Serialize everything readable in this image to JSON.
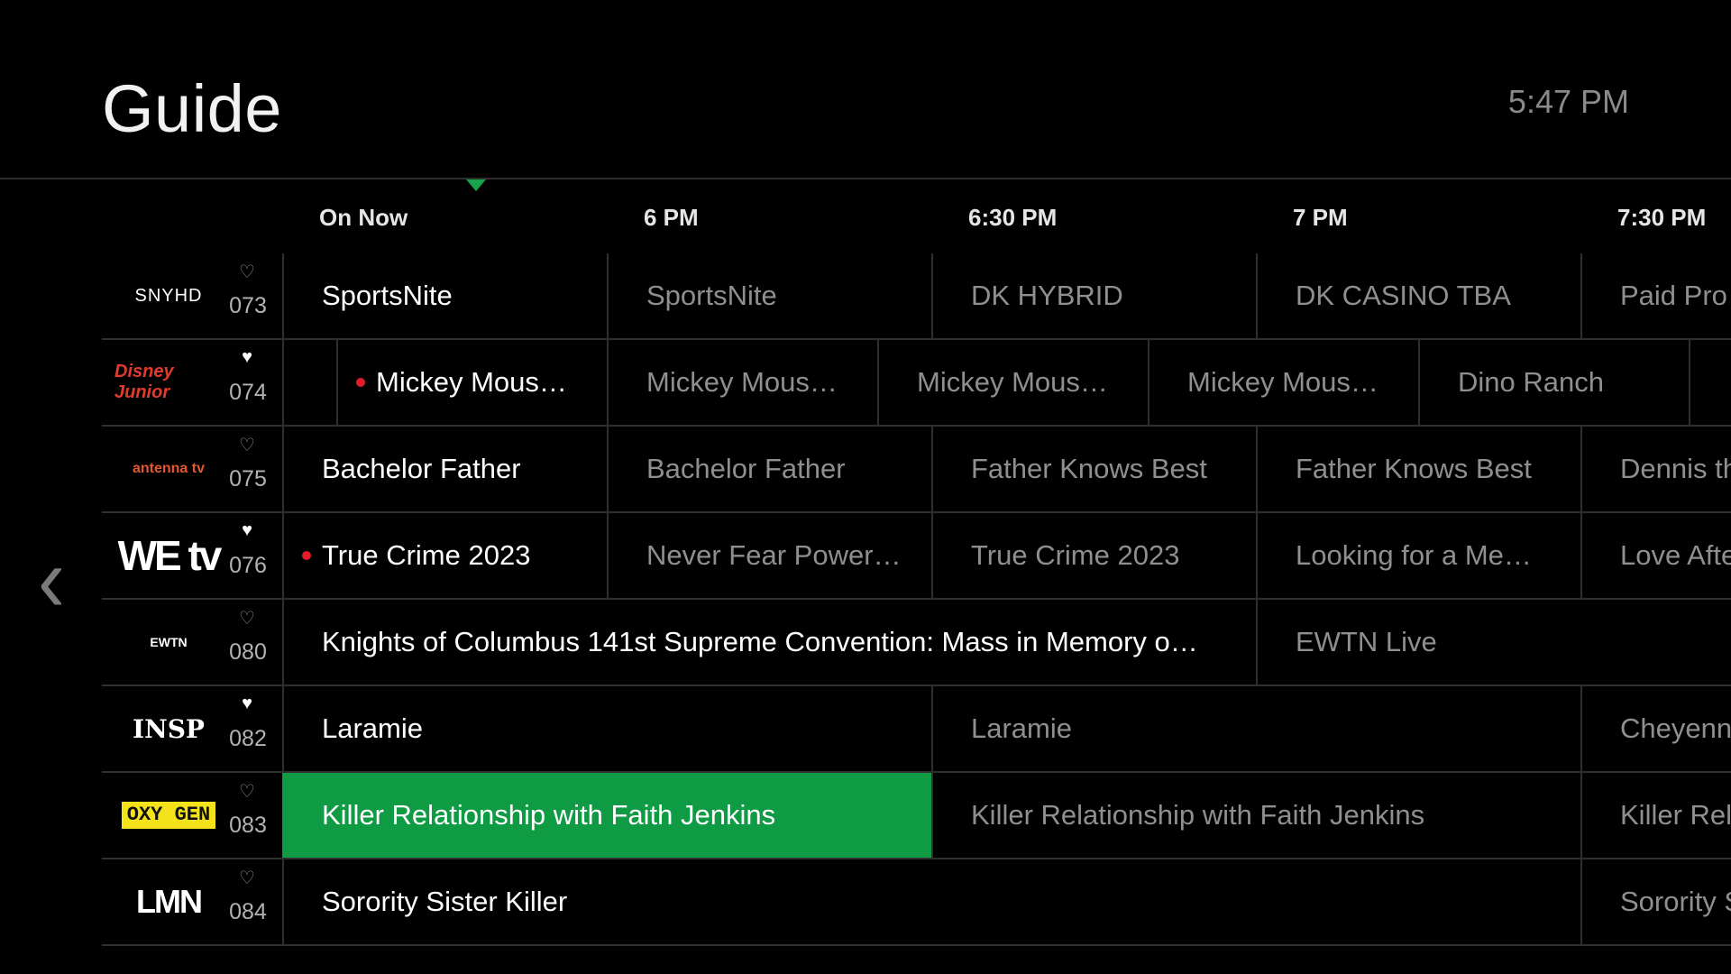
{
  "header": {
    "title": "Guide",
    "clock": "5:47 PM"
  },
  "timebar": [
    "On Now",
    "6 PM",
    "6:30 PM",
    "7 PM",
    "7:30 PM"
  ],
  "rows": [
    {
      "channel": {
        "logo_text": "SNYHD",
        "number": "073",
        "favorite": false
      },
      "programs": [
        "SportsNite",
        "SportsNite",
        "DK HYBRID",
        "DK CASINO TBA",
        "Paid Pro"
      ]
    },
    {
      "channel": {
        "logo_text": "Disney Junior",
        "number": "074",
        "favorite": true
      },
      "programs": [
        "Mickey Mous…",
        "Mickey Mous…",
        "Mickey Mous…",
        "Mickey Mous…",
        "Dino Ranch"
      ]
    },
    {
      "channel": {
        "logo_text": "antenna tv",
        "number": "075",
        "favorite": false
      },
      "programs": [
        "Bachelor Father",
        "Bachelor Father",
        "Father Knows Best",
        "Father Knows Best",
        "Dennis th"
      ]
    },
    {
      "channel": {
        "logo_text": "WE tv",
        "number": "076",
        "favorite": true
      },
      "programs": [
        "True Crime 2023",
        "Never Fear Power…",
        "True Crime 2023",
        "Looking for a Me…",
        "Love Afte"
      ]
    },
    {
      "channel": {
        "logo_text": "EWTN",
        "number": "080",
        "favorite": false
      },
      "programs": [
        "Knights of Columbus 141st Supreme Convention: Mass in Memory o…",
        "EWTN Live"
      ]
    },
    {
      "channel": {
        "logo_text": "INSP",
        "number": "082",
        "favorite": true
      },
      "programs": [
        "Laramie",
        "Laramie",
        "Cheyenn"
      ]
    },
    {
      "channel": {
        "logo_text": "OXY GEN",
        "number": "083",
        "favorite": false
      },
      "programs": [
        "Killer Relationship with Faith Jenkins",
        "Killer Relationship with Faith Jenkins",
        "Killer Rel"
      ]
    },
    {
      "channel": {
        "logo_text": "LMN",
        "number": "084",
        "favorite": false
      },
      "programs": [
        "Sorority Sister Killer",
        "Sorority S"
      ]
    }
  ],
  "icons": {
    "heart_empty": "♡",
    "heart_full": "♥",
    "left": "‹"
  },
  "colors": {
    "accent": "#0f9a44",
    "live_dot": "#e11d2a"
  }
}
